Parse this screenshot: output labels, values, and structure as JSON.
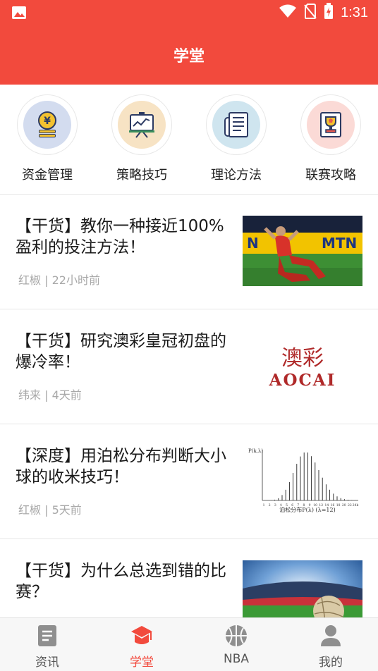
{
  "status_bar": {
    "time": "1:31"
  },
  "header": {
    "title": "学堂"
  },
  "categories": [
    {
      "label": "资金管理",
      "icon": "coin-stack-icon",
      "disc_color": "#d3dcef"
    },
    {
      "label": "策略技巧",
      "icon": "strategy-board-icon",
      "disc_color": "#f7e3c4"
    },
    {
      "label": "理论方法",
      "icon": "document-icon",
      "disc_color": "#cfe5ef"
    },
    {
      "label": "联赛攻略",
      "icon": "trophy-icon",
      "disc_color": "#fbdad6"
    }
  ],
  "articles": [
    {
      "title": "【干货】教你一种接近100%盈利的投注方法！",
      "author": "红椒",
      "time": "22小时前",
      "thumb": "football-player-photo"
    },
    {
      "title": "【干货】研究澳彩皇冠初盘的爆冷率！",
      "author": "纬来",
      "time": "4天前",
      "thumb": "aocai-logo",
      "thumb_text_cn": "澳彩",
      "thumb_text_en": "AOCAI"
    },
    {
      "title": "【深度】用泊松分布判断大小球的收米技巧！",
      "author": "红椒",
      "time": "5天前",
      "thumb": "poisson-distribution-chart",
      "chart_y_label": "P(k,λ)",
      "chart_x_ticks": [
        "1",
        "2",
        "3",
        "4",
        "5",
        "6",
        "7",
        "8",
        "9",
        "10",
        "12",
        "14",
        "16",
        "18",
        "20",
        "22",
        "24k"
      ],
      "chart_caption": "泊松分布P(λ) (λ=12)"
    },
    {
      "title": "【干货】为什么总选到错的比赛？",
      "author": "",
      "time": "",
      "thumb": "stadium-ball-photo"
    }
  ],
  "tabs": [
    {
      "label": "资讯",
      "icon": "news-icon",
      "active": false
    },
    {
      "label": "学堂",
      "icon": "graduation-cap-icon",
      "active": true
    },
    {
      "label": "NBA",
      "icon": "basketball-icon",
      "active": false
    },
    {
      "label": "我的",
      "icon": "user-icon",
      "active": false
    }
  ],
  "colors": {
    "brand": "#f24a3d",
    "inactive_icon": "#8f8f8f",
    "meta_text": "#a8a8a8"
  }
}
